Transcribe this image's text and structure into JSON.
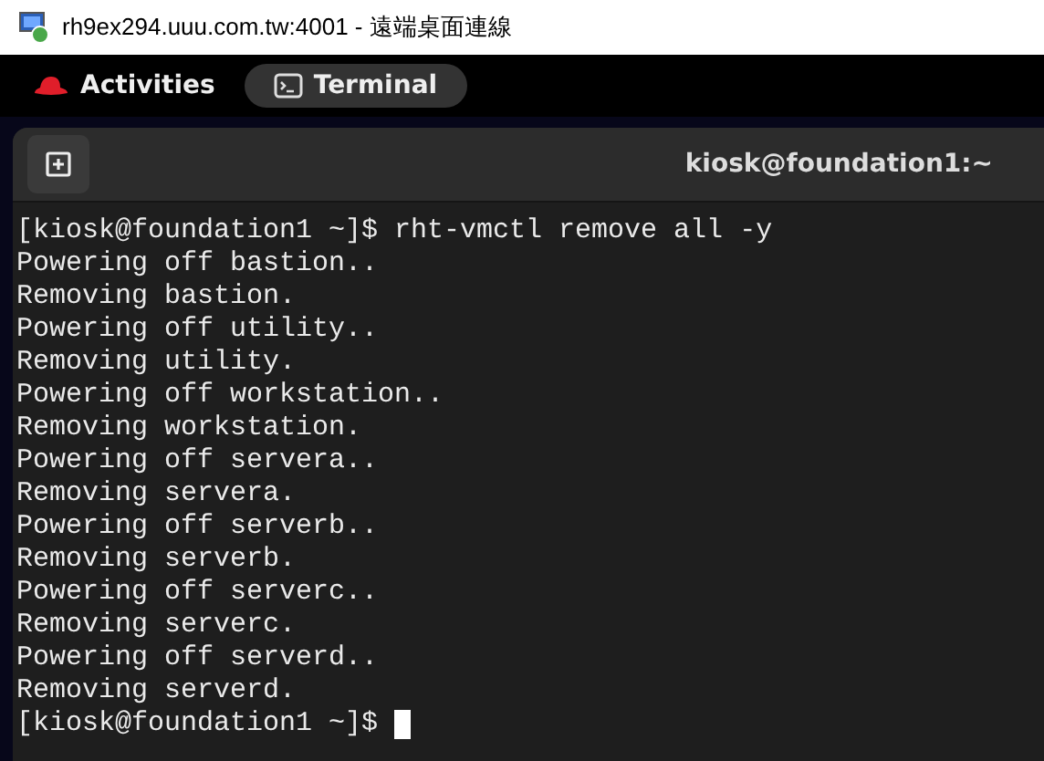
{
  "window": {
    "title": "rh9ex294.uuu.com.tw:4001 - 遠端桌面連線"
  },
  "top_bar": {
    "activities": "Activities",
    "app": "Terminal"
  },
  "terminal": {
    "title": "kiosk@foundation1:~",
    "cursor": true,
    "lines": [
      "[kiosk@foundation1 ~]$ rht-vmctl remove all -y",
      "Powering off bastion..",
      "Removing bastion.",
      "Powering off utility..",
      "Removing utility.",
      "Powering off workstation..",
      "Removing workstation.",
      "Powering off servera..",
      "Removing servera.",
      "Powering off serverb..",
      "Removing serverb.",
      "Powering off serverc..",
      "Removing serverc.",
      "Powering off serverd..",
      "Removing serverd.",
      "[kiosk@foundation1 ~]$ "
    ]
  }
}
